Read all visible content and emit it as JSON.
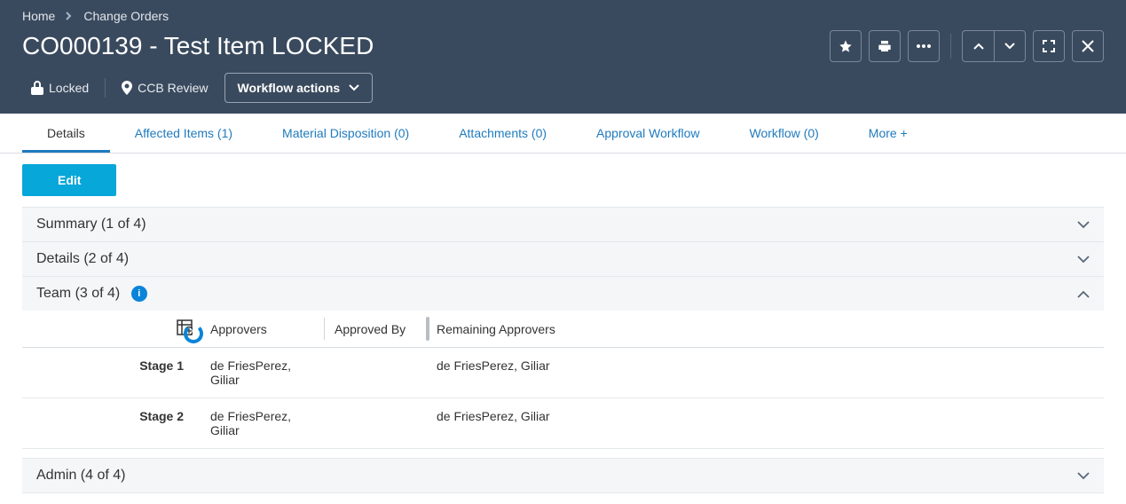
{
  "breadcrumb": {
    "home": "Home",
    "current": "Change Orders"
  },
  "page_title": "CO000139 - Test Item LOCKED",
  "status": {
    "locked_label": "Locked",
    "review_label": "CCB Review",
    "workflow_button": "Workflow actions"
  },
  "tabs": {
    "details": "Details",
    "affected": "Affected Items (1)",
    "material": "Material Disposition (0)",
    "attachments": "Attachments (0)",
    "approval": "Approval Workflow",
    "workflow": "Workflow (0)",
    "more": "More +"
  },
  "edit_label": "Edit",
  "sections": {
    "summary": "Summary (1 of 4)",
    "details": "Details (2 of 4)",
    "team": "Team (3 of 4)",
    "admin": "Admin (4 of 4)"
  },
  "team_table": {
    "headers": {
      "approvers": "Approvers",
      "approved_by": "Approved By",
      "remaining": "Remaining Approvers"
    },
    "rows": [
      {
        "stage": "Stage 1",
        "approvers": "de FriesPerez, Giliar",
        "approved_by": "",
        "remaining": "de FriesPerez, Giliar"
      },
      {
        "stage": "Stage 2",
        "approvers": "de FriesPerez, Giliar",
        "approved_by": "",
        "remaining": "de FriesPerez, Giliar"
      }
    ]
  }
}
